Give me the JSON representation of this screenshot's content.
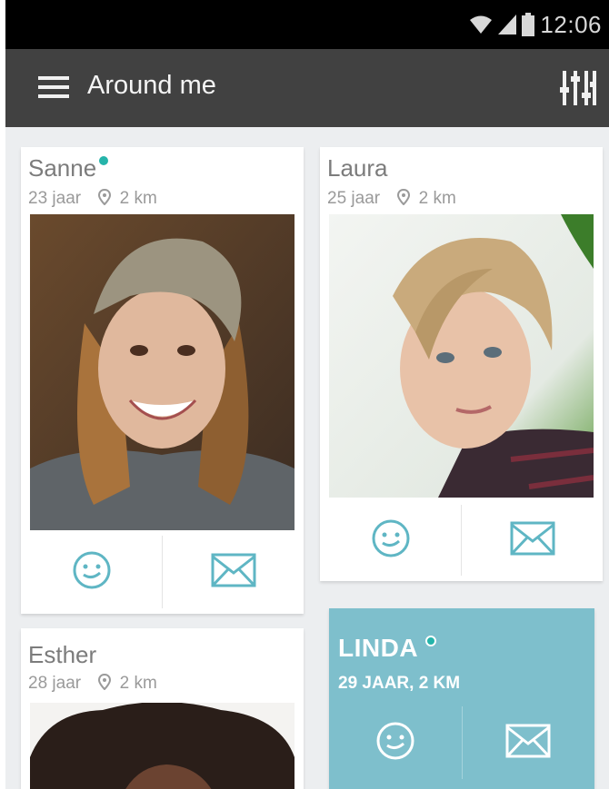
{
  "status_bar": {
    "time": "12:06",
    "icons": [
      "wifi-icon",
      "signal-icon",
      "battery-icon"
    ]
  },
  "app_bar": {
    "title": "Around me",
    "menu_icon": "hamburger-menu-icon",
    "filter_icon": "filter-sliders-icon"
  },
  "profiles": [
    {
      "name": "Sanne",
      "age": "23 jaar",
      "distance": "2 km",
      "online": true
    },
    {
      "name": "Laura",
      "age": "25 jaar",
      "distance": "2 km",
      "online": false
    },
    {
      "name": "Esther",
      "age": "28 jaar",
      "distance": "2 km",
      "online": false
    }
  ],
  "featured": {
    "name": "LINDA",
    "details": "29 JAAR, 2 KM",
    "online": true
  },
  "actions": {
    "smile_icon": "smiley-icon",
    "message_icon": "envelope-icon"
  },
  "colors": {
    "accent": "#5fb6c4",
    "online": "#25b4aa",
    "appbar": "#414141",
    "featured_bg": "#7ebfcc"
  }
}
